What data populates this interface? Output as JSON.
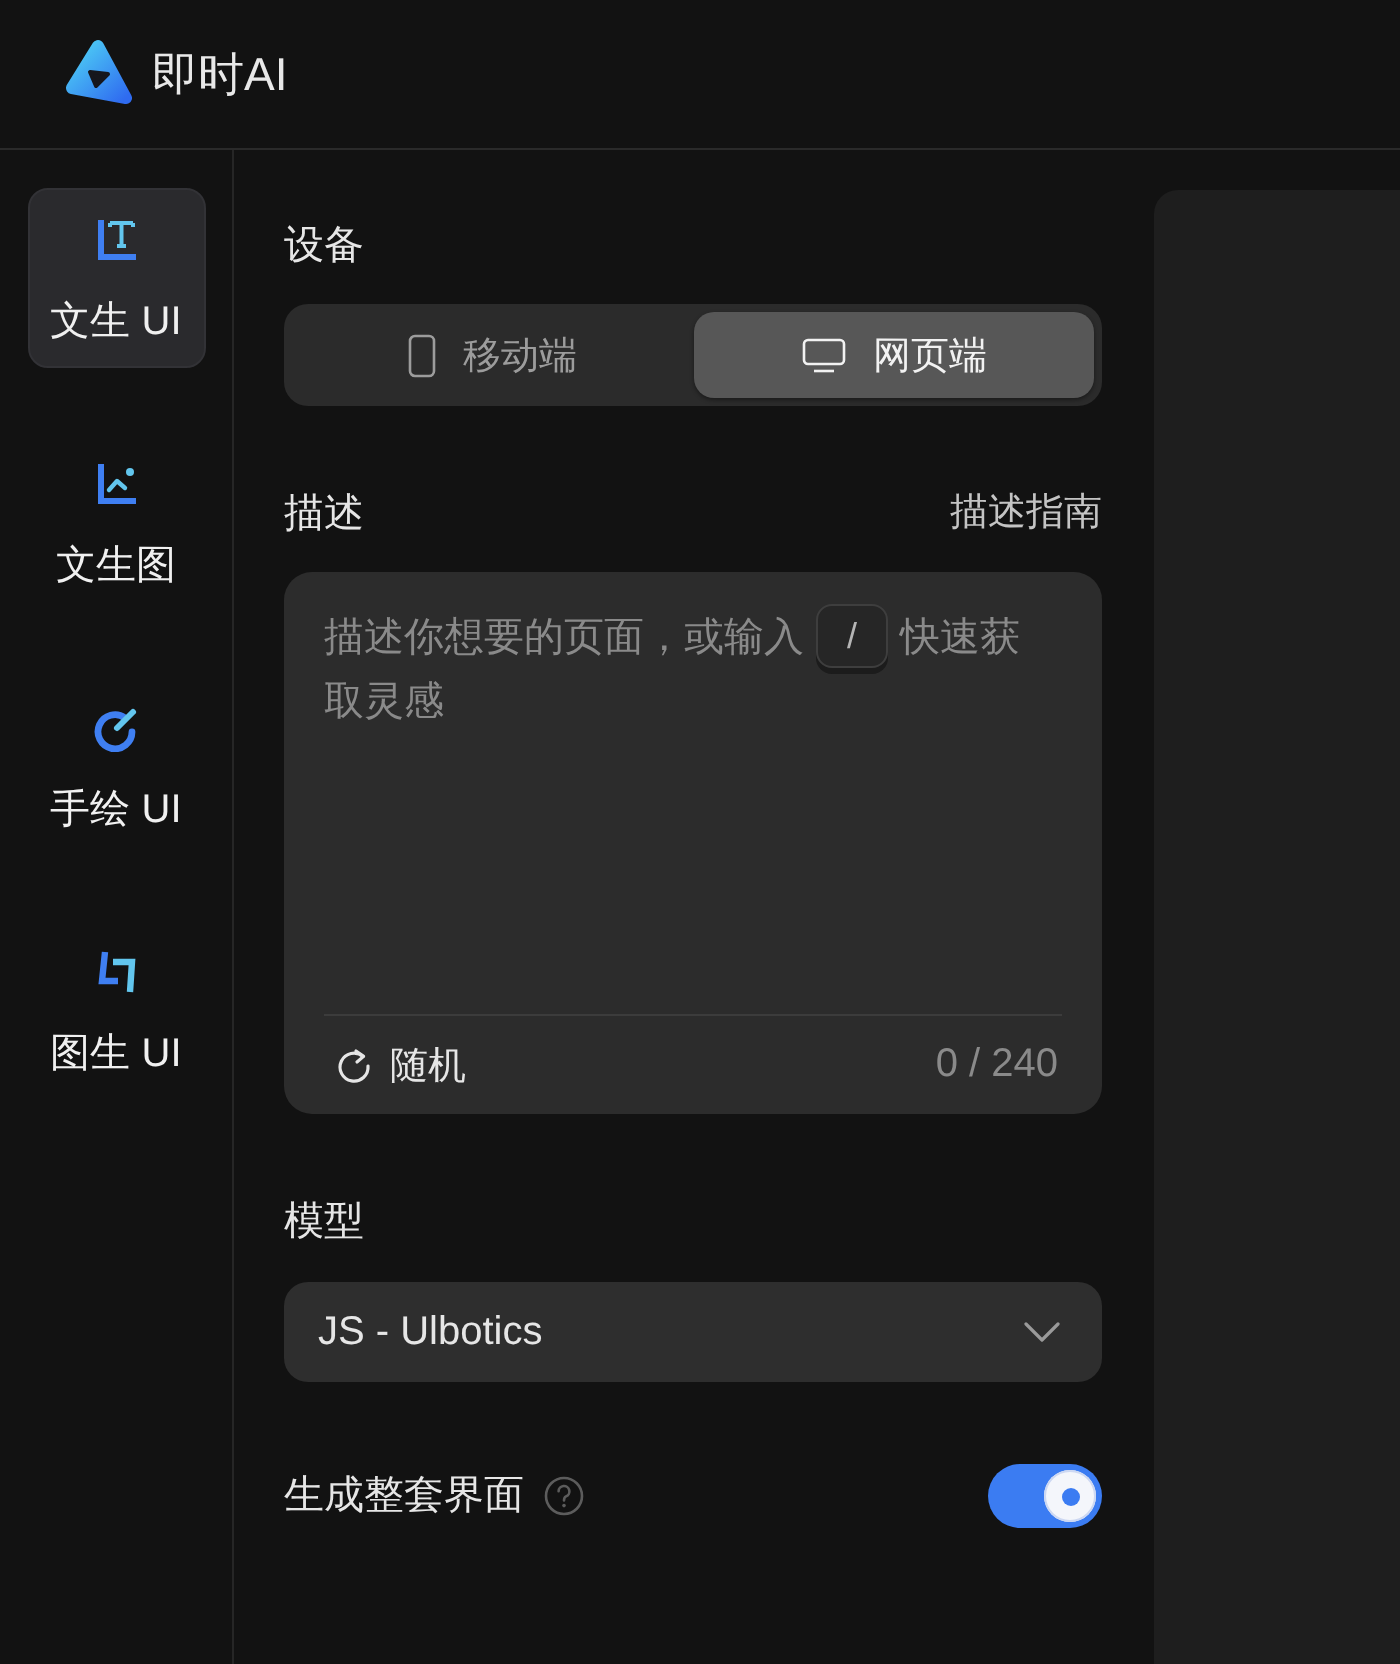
{
  "app": {
    "name": "即时AI"
  },
  "sidebar": {
    "items": [
      {
        "label": "文生 UI",
        "selected": true
      },
      {
        "label": "文生图",
        "selected": false
      },
      {
        "label": "手绘 UI",
        "selected": false
      },
      {
        "label": "图生 UI",
        "selected": false
      }
    ]
  },
  "device": {
    "label": "设备",
    "options": [
      {
        "label": "移动端",
        "selected": false
      },
      {
        "label": "网页端",
        "selected": true
      }
    ]
  },
  "description": {
    "label": "描述",
    "guide_link": "描述指南",
    "placeholder": [
      {
        "kind": "text",
        "text": "描述你想要的页面，或输入"
      },
      {
        "kind": "key",
        "text": "/"
      },
      {
        "kind": "text",
        "text": "快速获取灵感"
      }
    ],
    "random_button": "随机",
    "counter": "0 / 240"
  },
  "model": {
    "label": "模型",
    "value": "JS - Ulbotics"
  },
  "full_set": {
    "label": "生成整套界面",
    "on": true
  }
}
